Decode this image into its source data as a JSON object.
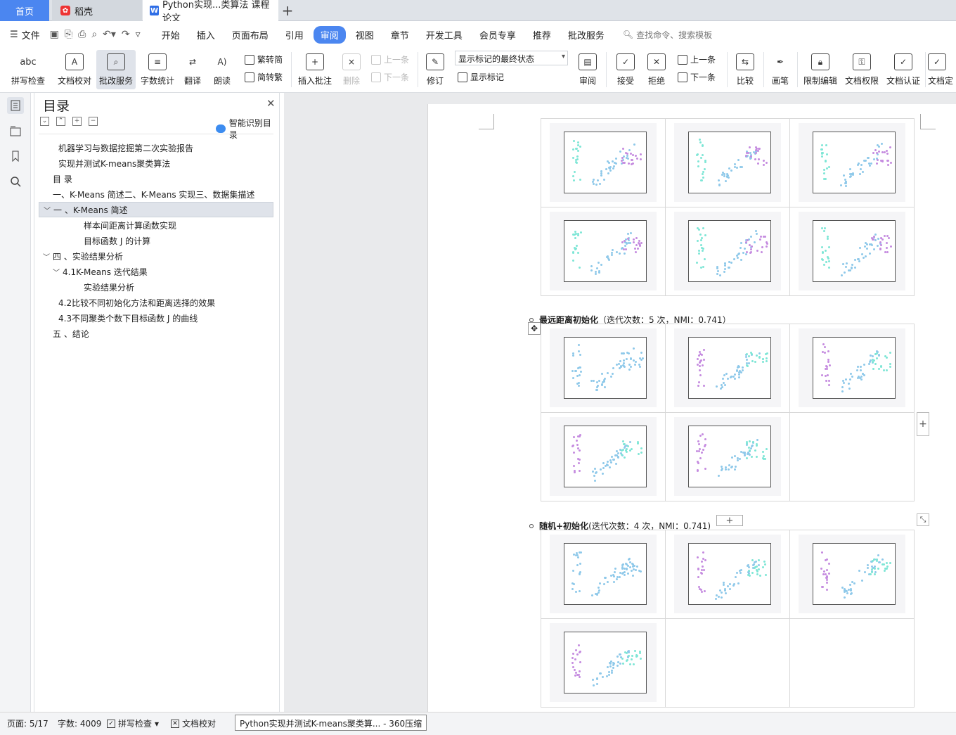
{
  "tabs": {
    "home": "首页",
    "daoke": "稻壳",
    "doc": "Python实现...类算法 课程论文"
  },
  "menu": {
    "file": "文件",
    "items": [
      "开始",
      "插入",
      "页面布局",
      "引用",
      "审阅",
      "视图",
      "章节",
      "开发工具",
      "会员专享",
      "推荐",
      "批改服务"
    ],
    "active": "审阅",
    "search": "查找命令、搜索模板"
  },
  "ribbon": {
    "spell": "拼写检查",
    "proof": "文档校对",
    "grading": "批改服务",
    "wordcount": "字数统计",
    "translate": "翻译",
    "read": "朗读",
    "trad2simp": "繁转简",
    "simp2trad": "简转繁",
    "insert_comment": "插入批注",
    "delete": "删除",
    "prev_comment": "上一条",
    "next_comment": "下一条",
    "revise": "修订",
    "markup_state": "显示标记的最终状态",
    "show_markup": "显示标记",
    "review": "审阅",
    "accept": "接受",
    "reject": "拒绝",
    "prev_change": "上一条",
    "next_change": "下一条",
    "compare": "比较",
    "pen": "画笔",
    "restrict": "限制编辑",
    "perm": "文档权限",
    "cert": "文档认证",
    "finalize": "文档定"
  },
  "nav": {
    "title": "目录",
    "smart": "智能识别目录",
    "items": [
      {
        "text": "机器学习与数据挖掘第二次实验报告",
        "level": 1,
        "chev": ""
      },
      {
        "text": "实现并测试K-means聚类算法",
        "level": 1,
        "chev": ""
      },
      {
        "text": "目 录",
        "level": 0,
        "chev": ""
      },
      {
        "text": "一、K-Means 简述二、K-Means 实现三、数据集描述",
        "level": 0,
        "chev": ""
      },
      {
        "text": "一 、K-Means 简述",
        "level": 0,
        "chev": "﹀"
      },
      {
        "text": "样本间距离计算函数实现",
        "level": 2,
        "chev": ""
      },
      {
        "text": "目标函数 J 的计算",
        "level": 2,
        "chev": ""
      },
      {
        "text": "四 、实验结果分析",
        "level": 0,
        "chev": "﹀"
      },
      {
        "text": "4.1K-Means 迭代结果",
        "level": 1,
        "chev": "﹀"
      },
      {
        "text": "实验结果分析",
        "level": 2,
        "chev": ""
      },
      {
        "text": "4.2比较不同初始化方法和距离选择的效果",
        "level": 1,
        "chev": ""
      },
      {
        "text": "4.3不同聚类个数下目标函数 J 的曲线",
        "level": 1,
        "chev": ""
      },
      {
        "text": "五 、结论",
        "level": 0,
        "chev": ""
      }
    ]
  },
  "doc": {
    "bullet1": {
      "title": "最远距离初始化",
      "detail": "（迭代次数：5 次，NMI：0.741）"
    },
    "bullet2": {
      "title": "随机+初始化",
      "detail": "(迭代次数：4 次，NMI：0.741)"
    }
  },
  "status": {
    "page": "页面: 5/17",
    "words": "字数: 4009",
    "spell": "拼写检查",
    "proof": "文档校对",
    "tooltip": "Python实现并测试K-means聚类算... - 360压缩"
  },
  "colors": {
    "accent": "#4b86f0",
    "blue": "#8ec9ea",
    "purple": "#c58be0",
    "teal": "#7ee6d6"
  }
}
